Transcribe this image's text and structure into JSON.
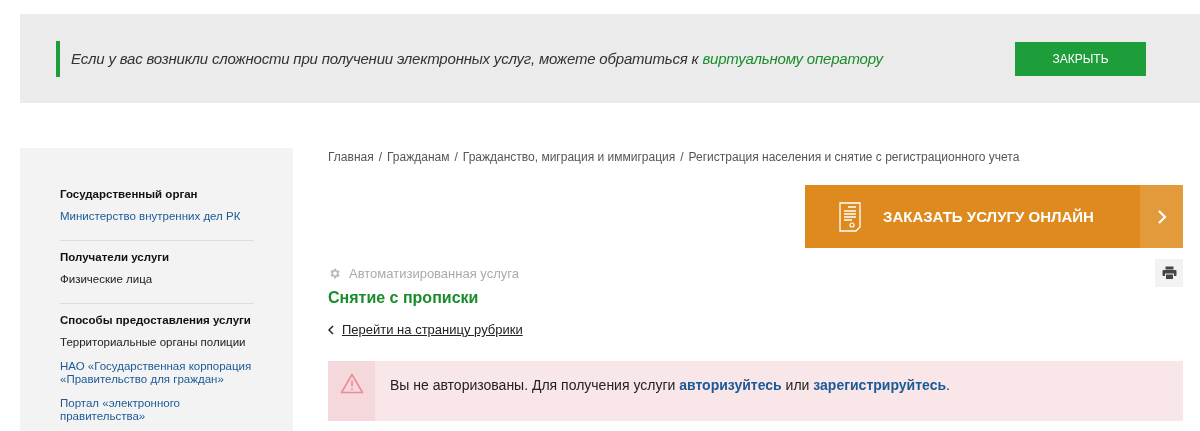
{
  "notice": {
    "text_before": "Если у вас возникли сложности при получении электронных услуг, можете обратиться к",
    "link": "виртуальному оператору",
    "close_button": "ЗАКРЫТЬ"
  },
  "sidebar": {
    "sections": [
      {
        "heading": "Государственный орган",
        "items": [
          {
            "text": "Министерство внутренних дел РК",
            "kind": "link"
          }
        ]
      },
      {
        "heading": "Получатели услуги",
        "items": [
          {
            "text": "Физические лица",
            "kind": "text"
          }
        ]
      },
      {
        "heading": "Способы предоставления услуги",
        "items": [
          {
            "text": "Территориальные органы полиции",
            "kind": "text"
          },
          {
            "text": "НАО «Государственная корпорация «Правительство для граждан»",
            "kind": "link"
          },
          {
            "text": "Портал «электронного правительства»",
            "kind": "link"
          }
        ]
      }
    ]
  },
  "breadcrumbs": {
    "separator": "/",
    "items": [
      "Главная",
      "Гражданам",
      "Гражданство, миграция и иммиграция",
      "Регистрация населения и снятие с регистрационного учета"
    ]
  },
  "order_button": {
    "label": "ЗАКАЗАТЬ УСЛУГУ ОНЛАЙН"
  },
  "service_type": "Автоматизированная услуга",
  "title": "Снятие с прописки",
  "back_link": "Перейти на страницу рубрики",
  "alert": {
    "text_before": "Вы не авторизованы. Для получения услуги",
    "link_login": "авторизуйтесь",
    "text_middle": "или",
    "link_register": "зарегистрируйтесь",
    "text_after": "."
  }
}
